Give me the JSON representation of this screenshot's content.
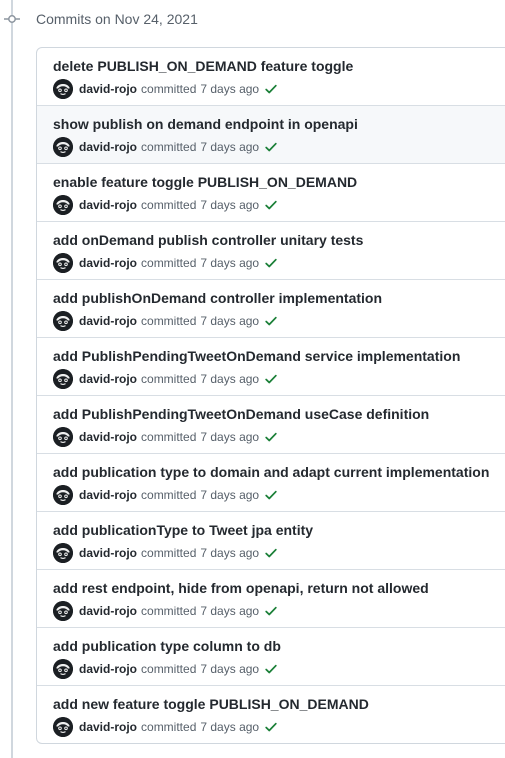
{
  "group": {
    "title": "Commits on Nov 24, 2021"
  },
  "colors": {
    "border": "#d0d7de",
    "muted": "#57606a",
    "text": "#24292f",
    "success": "#1a7f37",
    "hover_bg": "#f6f8fa"
  },
  "icons": {
    "timeline_node": "git-commit-icon",
    "status": "check-icon"
  },
  "commits": [
    {
      "title": "delete PUBLISH_ON_DEMAND feature toggle",
      "author": "david-rojo",
      "action": "committed",
      "time": "7 days ago"
    },
    {
      "title": "show publish on demand endpoint in openapi",
      "author": "david-rojo",
      "action": "committed",
      "time": "7 days ago"
    },
    {
      "title": "enable feature toggle PUBLISH_ON_DEMAND",
      "author": "david-rojo",
      "action": "committed",
      "time": "7 days ago"
    },
    {
      "title": "add onDemand publish controller unitary tests",
      "author": "david-rojo",
      "action": "committed",
      "time": "7 days ago"
    },
    {
      "title": "add publishOnDemand controller implementation",
      "author": "david-rojo",
      "action": "committed",
      "time": "7 days ago"
    },
    {
      "title": "add PublishPendingTweetOnDemand service implementation",
      "author": "david-rojo",
      "action": "committed",
      "time": "7 days ago"
    },
    {
      "title": "add PublishPendingTweetOnDemand useCase definition",
      "author": "david-rojo",
      "action": "committed",
      "time": "7 days ago"
    },
    {
      "title": "add publication type to domain and adapt current implementation",
      "author": "david-rojo",
      "action": "committed",
      "time": "7 days ago"
    },
    {
      "title": "add publicationType to Tweet jpa entity",
      "author": "david-rojo",
      "action": "committed",
      "time": "7 days ago"
    },
    {
      "title": "add rest endpoint, hide from openapi, return not allowed",
      "author": "david-rojo",
      "action": "committed",
      "time": "7 days ago"
    },
    {
      "title": "add publication type column to db",
      "author": "david-rojo",
      "action": "committed",
      "time": "7 days ago"
    },
    {
      "title": "add new feature toggle PUBLISH_ON_DEMAND",
      "author": "david-rojo",
      "action": "committed",
      "time": "7 days ago"
    }
  ]
}
